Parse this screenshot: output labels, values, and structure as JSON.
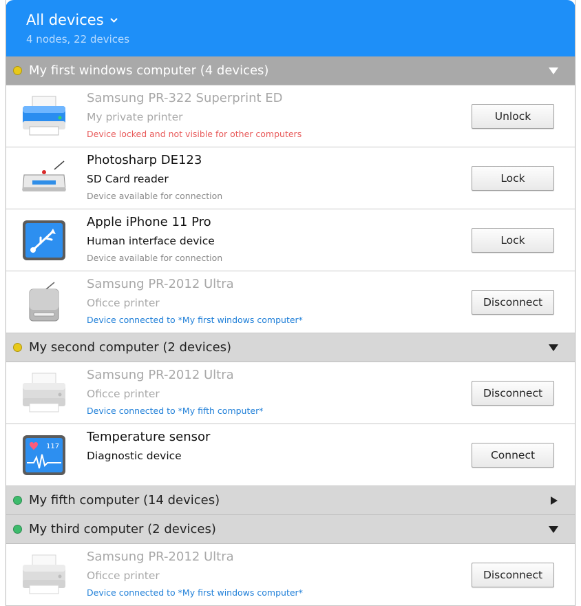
{
  "header": {
    "title": "All devices",
    "subtitle": "4 nodes, 22 devices"
  },
  "groups": [
    {
      "title": "My first windows computer (4 devices)",
      "dot_color": "#e8c91a",
      "arrow": "down",
      "devices": [
        {
          "name": "Samsung PR-322 Superprint ED",
          "description": "My private printer",
          "status": "Device locked and not visible for other computers",
          "status_tone": "red",
          "button": "Unlock",
          "icon": "printer-icon",
          "dim": true
        },
        {
          "name": "Photosharp DE123",
          "description": "SD Card reader",
          "status": "Device available for connection",
          "status_tone": "grey",
          "button": "Lock",
          "icon": "card-reader-icon",
          "dim": false
        },
        {
          "name": "Apple iPhone 11 Pro",
          "description": "Human interface device",
          "status": "Device available for connection",
          "status_tone": "grey",
          "button": "Lock",
          "icon": "usb-icon",
          "dim": false
        },
        {
          "name": "Samsung PR-2012 Ultra",
          "description": "Oficce printer",
          "status": "Device connected to *My first windows computer*",
          "status_tone": "blue",
          "button": "Disconnect",
          "icon": "hard-drive-icon",
          "dim": true
        }
      ]
    },
    {
      "title": "My second computer (2 devices)",
      "dot_color": "#e8c91a",
      "arrow": "down",
      "devices": [
        {
          "name": "Samsung PR-2012 Ultra",
          "description": "Oficce printer",
          "status": "Device connected to *My fifth computer*",
          "status_tone": "blue",
          "button": "Disconnect",
          "icon": "printer-grey-icon",
          "dim": true
        },
        {
          "name": "Temperature sensor",
          "description": "Diagnostic device",
          "status": "",
          "status_tone": "grey",
          "button": "Connect",
          "icon": "heart-monitor-icon",
          "dim": false,
          "heart_value": "117"
        }
      ]
    },
    {
      "title": "My fifth computer (14 devices)",
      "dot_color": "#3dbb6c",
      "arrow": "right",
      "devices": []
    },
    {
      "title": "My third computer (2 devices)",
      "dot_color": "#3dbb6c",
      "arrow": "down",
      "devices": [
        {
          "name": "Samsung PR-2012 Ultra",
          "description": "Oficce printer",
          "status": "Device connected to *My first windows computer*",
          "status_tone": "blue",
          "button": "Disconnect",
          "icon": "printer-grey-icon",
          "dim": true
        }
      ]
    }
  ]
}
